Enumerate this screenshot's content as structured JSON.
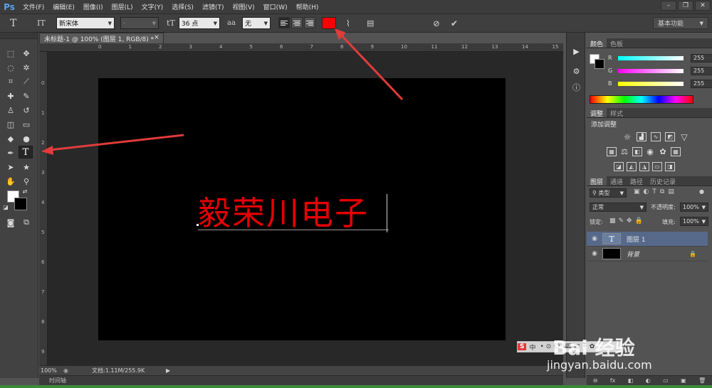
{
  "app": {
    "logo": "Ps"
  },
  "menu": [
    "文件(F)",
    "编辑(E)",
    "图像(I)",
    "图层(L)",
    "文字(Y)",
    "选择(S)",
    "滤镜(T)",
    "视图(V)",
    "窗口(W)",
    "帮助(H)"
  ],
  "window_controls": [
    "–",
    "❐",
    "✕"
  ],
  "options": {
    "tool_glyph": "T",
    "orient_glyph": "IT",
    "font_family": "新宋体",
    "font_style": "-",
    "size_glyph": "tT",
    "font_size": "36 点",
    "aa_glyph": "aa",
    "antialias": "无",
    "text_color": "#ff0000",
    "workspace": "基本功能"
  },
  "document": {
    "tab_title": "未标题-1 @ 100% (图层 1, RGB/8) *",
    "tab_close": "×",
    "canvas_text": "毅荣川电子",
    "canvas_text_color": "#e60000",
    "ruler_h": [
      "0",
      "1",
      "2",
      "3",
      "4",
      "5",
      "6",
      "7",
      "8",
      "9",
      "10",
      "11",
      "12",
      "13",
      "14",
      "15"
    ],
    "ruler_v": [
      "0",
      "1",
      "2",
      "3",
      "4",
      "5",
      "6",
      "7",
      "8",
      "9"
    ]
  },
  "status": {
    "zoom": "100%",
    "doc_info": "文档:1.11M/255.9K"
  },
  "timeline": {
    "label": "时间轴"
  },
  "color_panel": {
    "tabs": [
      "颜色",
      "色板"
    ],
    "channels": [
      {
        "label": "R",
        "value": "255"
      },
      {
        "label": "G",
        "value": "255"
      },
      {
        "label": "B",
        "value": "255"
      }
    ]
  },
  "adjust_panel": {
    "tabs": [
      "调整",
      "样式"
    ],
    "title": "添加调整"
  },
  "layers_panel": {
    "tabs": [
      "图层",
      "通道",
      "路径",
      "历史记录"
    ],
    "filter_kind": "类型",
    "blend_mode": "正常",
    "opacity_label": "不透明度:",
    "opacity": "100%",
    "lock_label": "锁定:",
    "fill_label": "填充:",
    "fill": "100%",
    "layers": [
      {
        "name": "图层 1",
        "type": "text",
        "selected": true
      },
      {
        "name": "背景",
        "type": "background",
        "selected": false
      }
    ],
    "bottom_icons": [
      "⊖",
      "fx",
      "◧",
      "◐",
      "▭",
      "▣",
      "🗑"
    ]
  },
  "watermark": {
    "brand": "Bai 经验",
    "url": "jingyan.baidu.com",
    "ime_label": "中"
  }
}
